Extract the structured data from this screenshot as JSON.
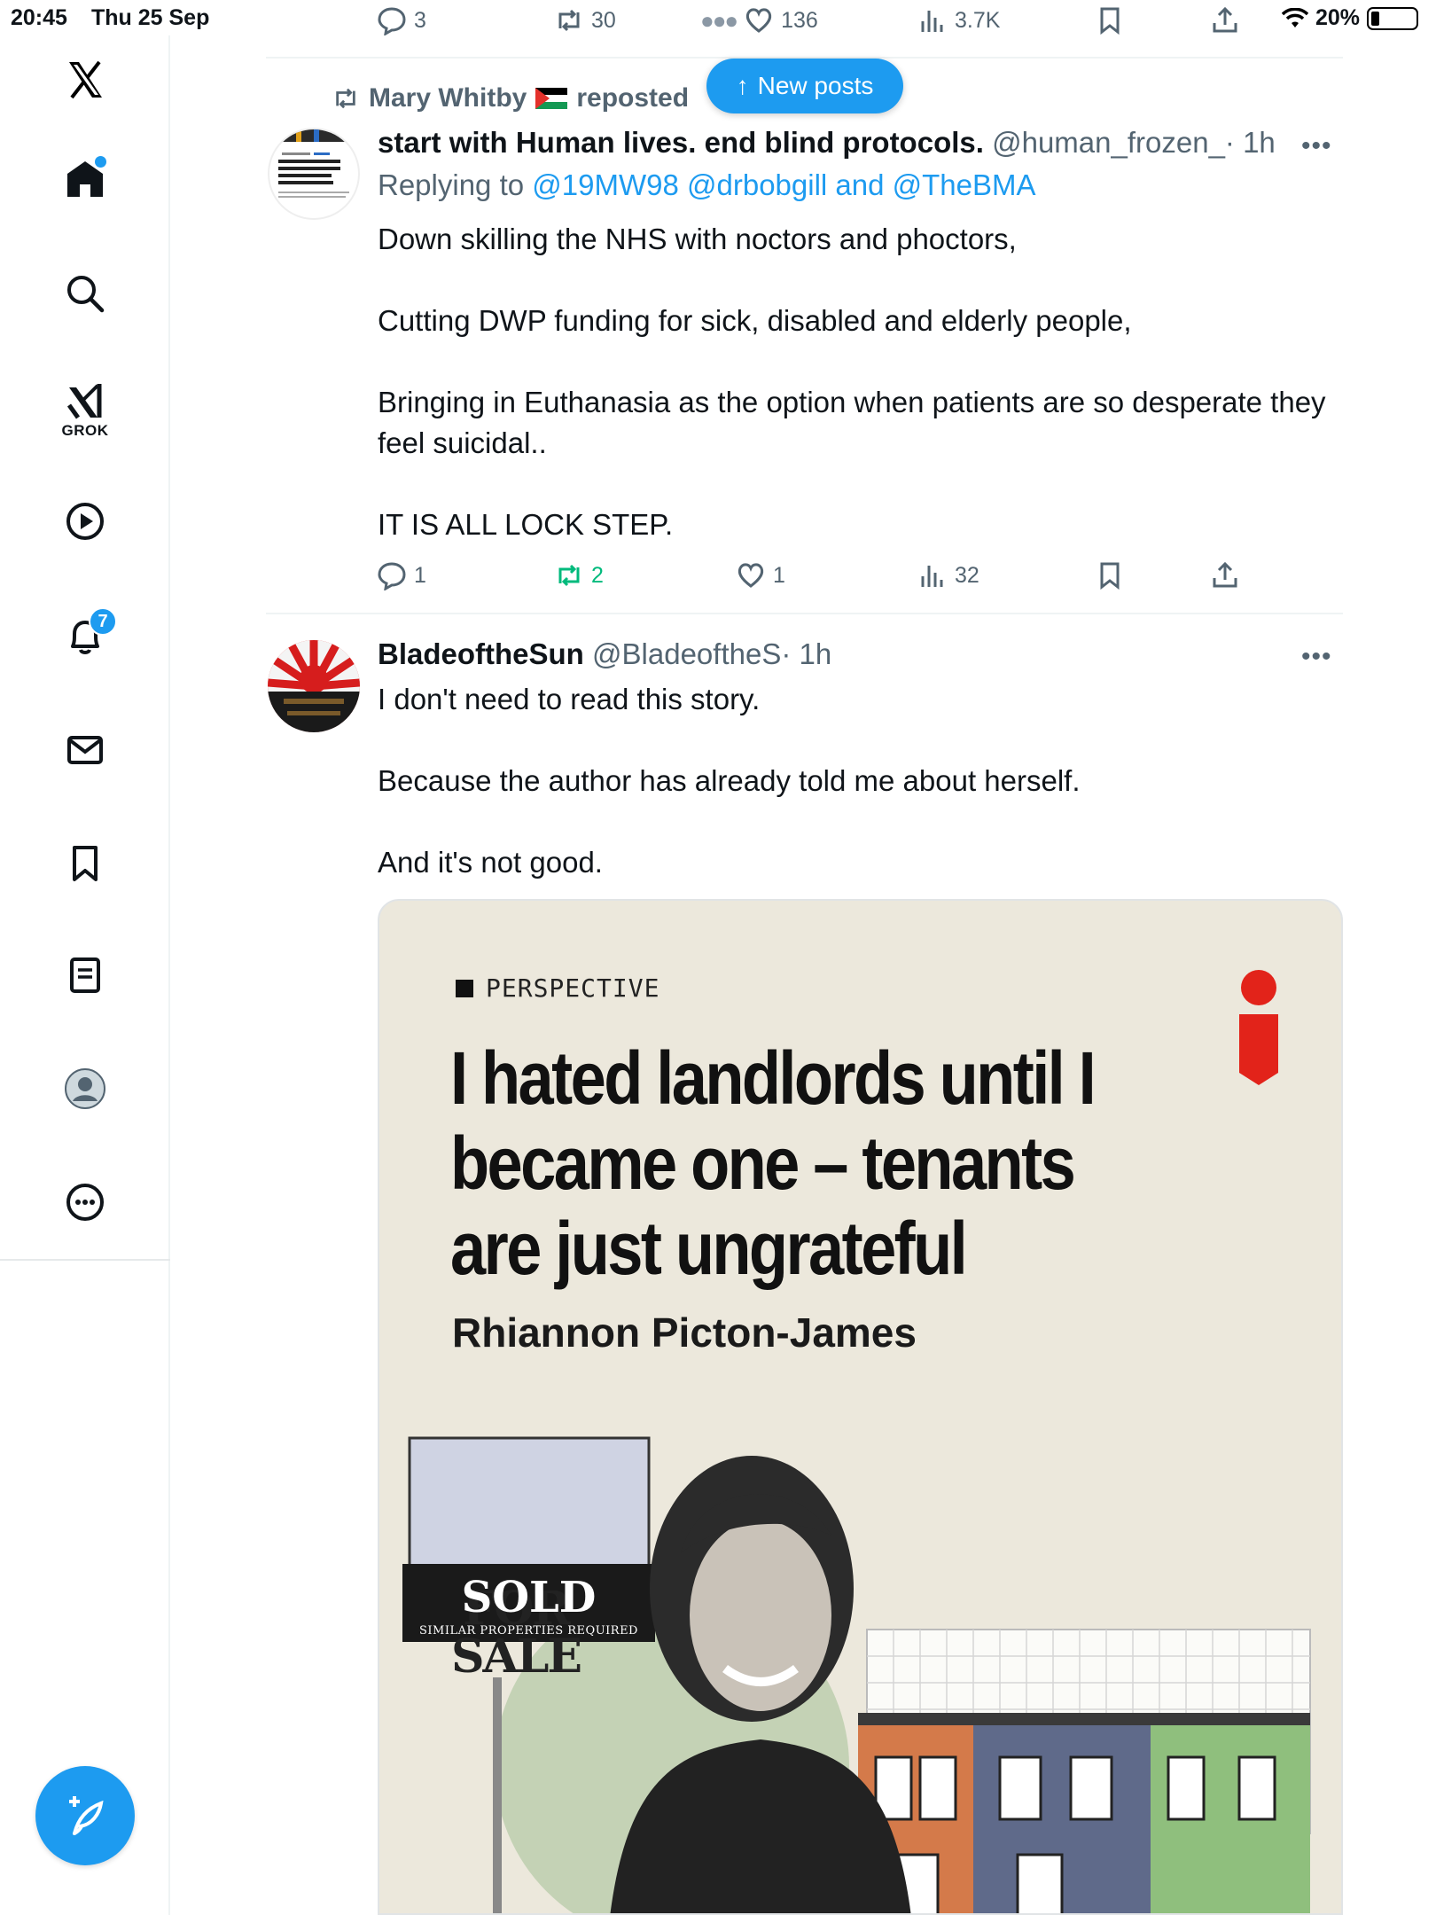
{
  "status_bar": {
    "time": "20:45",
    "date": "Thu 25 Sep",
    "battery": "20%"
  },
  "top_actions": {
    "replies": "3",
    "reposts": "30",
    "likes": "136",
    "views": "3.7K"
  },
  "new_posts": {
    "label": "New posts"
  },
  "sidebar": {
    "grok_label": "GROK",
    "notifications_count": "7"
  },
  "tweet1": {
    "reposted_by": "Mary Whitby",
    "reposted_label": "reposted",
    "author_name": "start with Human lives. end blind protocols.",
    "handle": "@human_frozen_",
    "time": "· 1h",
    "replying_to_label": "Replying to",
    "replying_to": "@19MW98 @drbobgill and @TheBMA",
    "text": "Down skilling the NHS with noctors and phoctors,\n\nCutting DWP funding for sick, disabled and elderly people,\n\nBringing in Euthanasia as the option when patients are so desperate they feel suicidal..\n\nIT IS ALL LOCK STEP.",
    "replies": "1",
    "reposts": "2",
    "likes": "1",
    "views": "32"
  },
  "tweet2": {
    "author_name": "BladeoftheSun",
    "handle": "@BladeoftheS",
    "time": "· 1h",
    "text": "I don't need to read this story.\n\nBecause the author has already told me about herself.\n\nAnd it's not good.",
    "card": {
      "kicker": "PERSPECTIVE",
      "headline": "I hated landlords until I became one – tenants are just ungrateful",
      "author": "Rhiannon Picton-James",
      "sign_top": "FOR SALE",
      "sign_sold": "SOLD",
      "sign_small": "SIMILAR PROPERTIES REQUIRED"
    }
  },
  "colors": {
    "accent": "#1d9bf0",
    "repost_green": "#00ba7c",
    "muted": "#536471",
    "brand_red": "#e2231a"
  }
}
